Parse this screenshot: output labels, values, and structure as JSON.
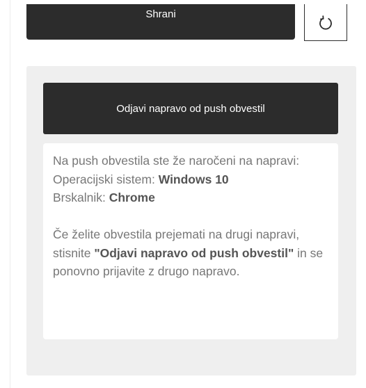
{
  "save_button": {
    "label": "Shrani"
  },
  "reset_button": {
    "icon": "reset-icon"
  },
  "panel": {
    "unsubscribe_button": {
      "label": "Odjavi napravo od push obvestil"
    },
    "info": {
      "line1": "Na push obvestila ste že naročeni na napravi:",
      "os_label": "Operacijski sistem: ",
      "os_value": "Windows 10",
      "browser_label": "Brskalnik: ",
      "browser_value": "Chrome",
      "p2_before": "Če želite obvestila prejemati na drugi napravi, stisnite ",
      "p2_bold": "\"Odjavi napravo od push obvestil\"",
      "p2_after": " in se ponovno prijavite z drugo napravo."
    }
  },
  "colors": {
    "dark_button": "#2c2c2c",
    "panel_bg": "#efefef",
    "text": "#777777",
    "bold_text": "#555555"
  }
}
